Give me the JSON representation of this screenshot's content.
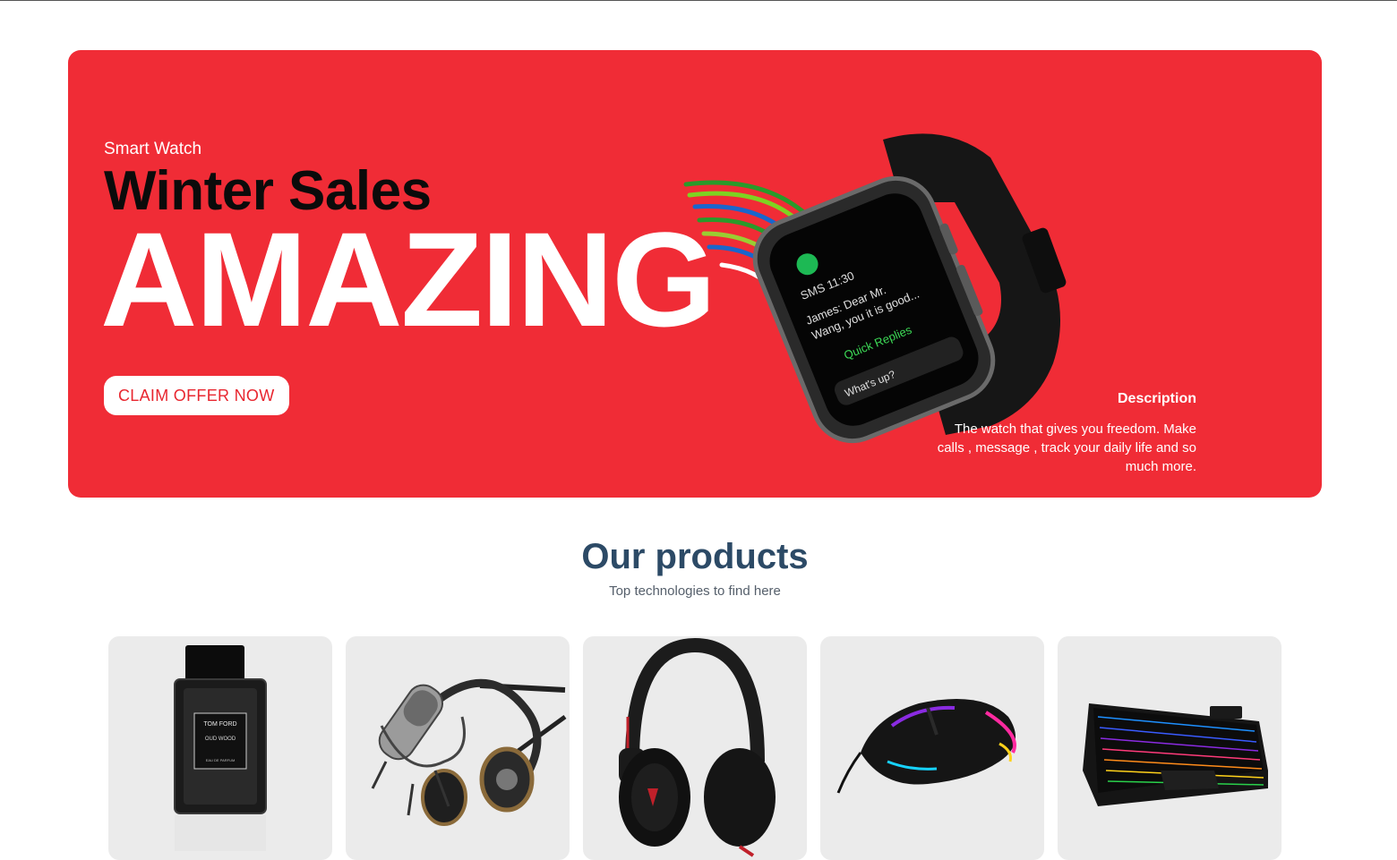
{
  "hero": {
    "subtitle": "Smart Watch",
    "title": "Winter Sales",
    "headline": "AMAZING",
    "cta_label": "CLAIM OFFER NOW",
    "description_title": "Description",
    "description_text": "The watch that gives you freedom. Make calls , message , track your daily life and so much more.",
    "watch_screen": {
      "line1": "SMS 11:30",
      "line2": "James: Dear Mr.",
      "line3": "Wang, you it is good...",
      "quick_replies": "Quick Replies",
      "reply": "What's up?"
    },
    "accent_color": "#f02c36"
  },
  "products_section": {
    "title": "Our products",
    "subtitle": "Top technologies to find here",
    "items": [
      {
        "icon": "perfume-bottle-icon",
        "brand_text": "TOM FORD",
        "name_text": "OUD WOOD",
        "extra_text": "EAU DE PARFUM"
      },
      {
        "icon": "microphone-headphones-icon"
      },
      {
        "icon": "headphones-icon"
      },
      {
        "icon": "gaming-mouse-icon"
      },
      {
        "icon": "gaming-keyboard-icon"
      }
    ]
  }
}
